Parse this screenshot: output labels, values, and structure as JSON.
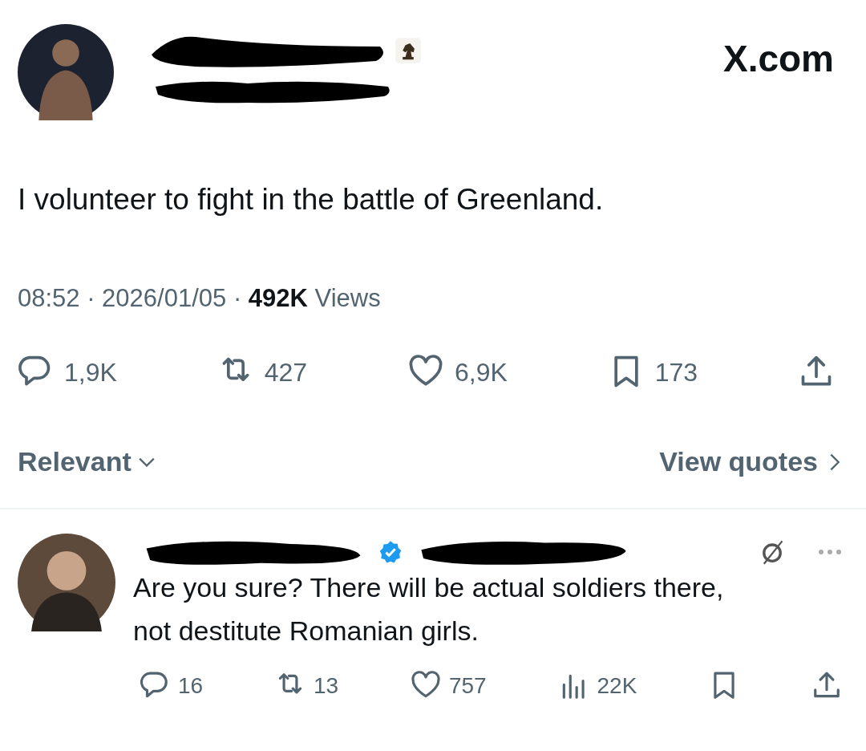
{
  "header": {
    "site": "X.com"
  },
  "post": {
    "text": "I volunteer to fight in the battle of Greenland.",
    "meta": "08:52 · 2026/01/05 · **492K** Views",
    "actions": [
      {
        "kind": "reply",
        "count": "1,9K"
      },
      {
        "kind": "repost",
        "count": "427"
      },
      {
        "kind": "like",
        "count": "6,9K"
      },
      {
        "kind": "bookmark",
        "count": "173"
      },
      {
        "kind": "share"
      }
    ]
  },
  "sort": {
    "label": "Relevant",
    "link": "View quotes"
  },
  "reply": {
    "text": "Are you sure? There will be actual soldiers there, not destitute Romanian girls.",
    "actions": [
      {
        "kind": "reply",
        "count": "16"
      },
      {
        "kind": "repost",
        "count": "13"
      },
      {
        "kind": "like",
        "count": "757"
      },
      {
        "kind": "views",
        "count": "22K"
      },
      {
        "kind": "bookmark"
      },
      {
        "kind": "share"
      }
    ]
  }
}
